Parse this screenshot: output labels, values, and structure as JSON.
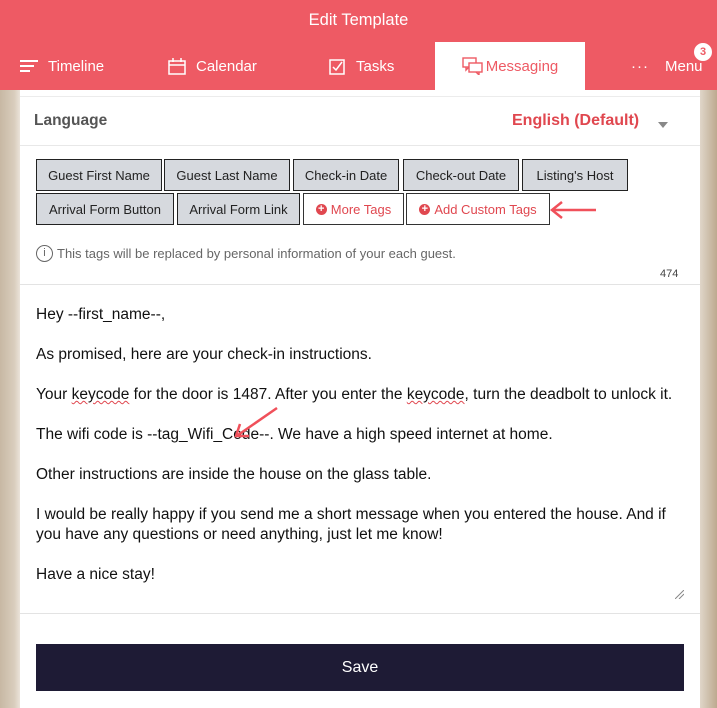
{
  "window": {
    "title": "Edit Template"
  },
  "nav": {
    "timeline": "Timeline",
    "calendar": "Calendar",
    "tasks": "Tasks",
    "messaging": "Messaging",
    "menu": "Menu",
    "menu_badge": "3",
    "brand_color": "#ee5a64"
  },
  "language": {
    "label": "Language",
    "value": "English (Default)"
  },
  "tags": {
    "row1": [
      "Guest First Name",
      "Guest Last Name",
      "Check-in Date",
      "Check-out Date",
      "Listing's Host"
    ],
    "row2": [
      "Arrival Form Button",
      "Arrival Form Link"
    ],
    "more_tags": "More Tags",
    "add_custom_tags": "Add Custom Tags"
  },
  "info": {
    "text": "This tags will be replaced by personal information of your each guest."
  },
  "char_count": "474",
  "message": {
    "line1": "Hey --first_name--,",
    "line2": "As promised, here are your check-in instructions.",
    "line3a": "Your ",
    "line3b": "keycode",
    "line3c": " for the door is 1487. After you enter the ",
    "line3d": "keycode",
    "line3e": ", turn the deadbolt to unlock it.",
    "line4": "The wifi code is --tag_Wifi_Code--. We have a high speed internet at home.",
    "line5": "Other instructions are inside the house on the glass table.",
    "line6": "I would be really happy if you send me a short message when you entered the house. And if you have any questions or need anything, just let me know!",
    "line7": "Have a nice stay!"
  },
  "save": {
    "label": "Save"
  }
}
